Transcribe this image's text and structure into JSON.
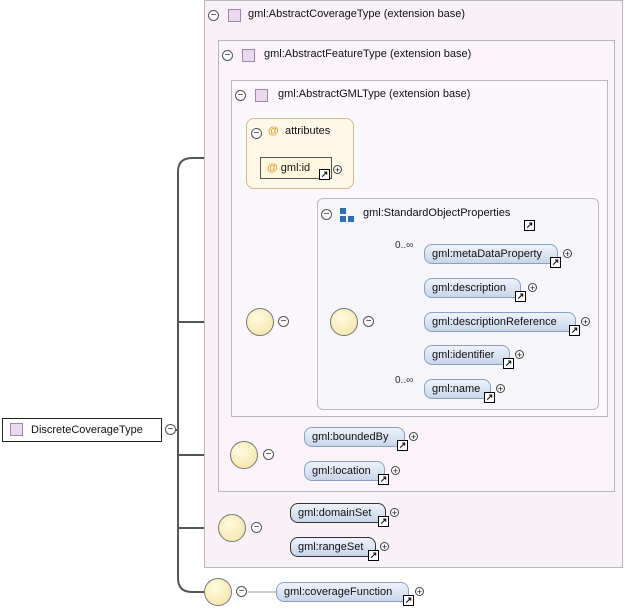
{
  "root": {
    "label": "DiscreteCoverageType"
  },
  "extensions": [
    {
      "label": "gml:AbstractCoverageType (extension base)"
    },
    {
      "label": "gml:AbstractFeatureType (extension base)"
    },
    {
      "label": "gml:AbstractGMLType (extension base)"
    }
  ],
  "attributes": {
    "label": "attributes",
    "items": [
      {
        "name": "gml:id"
      }
    ]
  },
  "group": {
    "label": "gml:StandardObjectProperties"
  },
  "elements": {
    "metaDataProperty": "gml:metaDataProperty",
    "description": "gml:description",
    "descriptionReference": "gml:descriptionReference",
    "identifier": "gml:identifier",
    "name": "gml:name",
    "boundedBy": "gml:boundedBy",
    "location": "gml:location",
    "domainSet": "gml:domainSet",
    "rangeSet": "gml:rangeSet",
    "coverageFunction": "gml:coverageFunction"
  },
  "cardinality": {
    "metaDataProperty": "0..∞",
    "name": "0..∞"
  },
  "symbols": {
    "collapse": "⊖",
    "expand": "+",
    "link": "↗",
    "attribute": "@"
  },
  "colors": {
    "element_fill": "#c8d5ea",
    "attribute_fill": "#fff6de",
    "extension_fill": "#f8f2f8"
  }
}
